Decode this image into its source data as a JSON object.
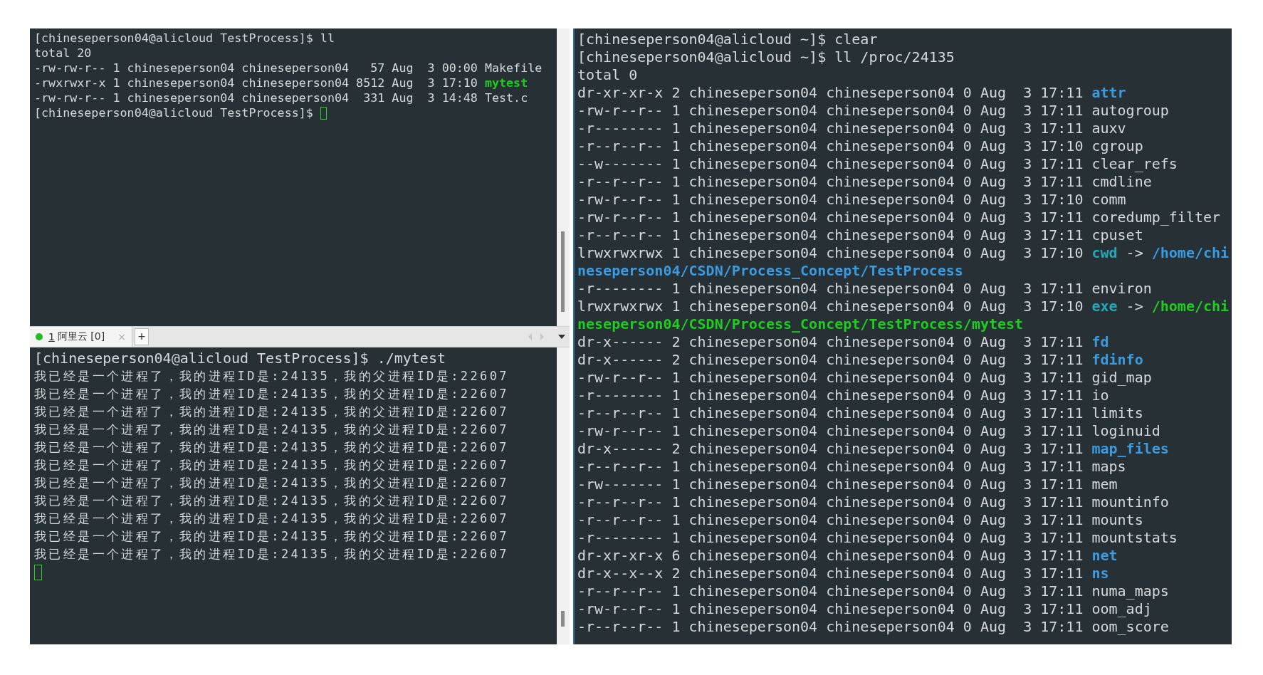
{
  "top_left_terminal": {
    "lines": [
      {
        "kind": "text",
        "text": "[chineseperson04@alicloud TestProcess]$ ll"
      },
      {
        "kind": "text",
        "text": "total 20"
      },
      {
        "kind": "listing",
        "details": "-rw-rw-r-- 1 chineseperson04 chineseperson04   57 Aug  3 00:00",
        "name": {
          "text": "Makefile",
          "kind": "file"
        }
      },
      {
        "kind": "listing",
        "details": "-rwxrwxr-x 1 chineseperson04 chineseperson04 8512 Aug  3 17:10",
        "name": {
          "text": "mytest",
          "kind": "exec"
        }
      },
      {
        "kind": "listing",
        "details": "-rw-rw-r-- 1 chineseperson04 chineseperson04  331 Aug  3 14:48",
        "name": {
          "text": "Test.c",
          "kind": "file"
        }
      },
      {
        "kind": "text",
        "text": "[chineseperson04@alicloud TestProcess]$",
        "cursor": true
      }
    ]
  },
  "tab_bar": {
    "tabs": [
      {
        "number": "1",
        "label": "阿里云 [0]",
        "color": "#22bb22",
        "close": "×",
        "selected": true
      }
    ],
    "add": "+"
  },
  "bottom_left_terminal": {
    "lines": [
      {
        "kind": "text",
        "text": "[chineseperson04@alicloud TestProcess]$ ./mytest"
      },
      {
        "kind": "output",
        "text": "我已经是一个进程了，我的进程ID是:24135，我的父进程ID是:22607"
      },
      {
        "kind": "output",
        "text": "我已经是一个进程了，我的进程ID是:24135，我的父进程ID是:22607"
      },
      {
        "kind": "output",
        "text": "我已经是一个进程了，我的进程ID是:24135，我的父进程ID是:22607"
      },
      {
        "kind": "output",
        "text": "我已经是一个进程了，我的进程ID是:24135，我的父进程ID是:22607"
      },
      {
        "kind": "output",
        "text": "我已经是一个进程了，我的进程ID是:24135，我的父进程ID是:22607"
      },
      {
        "kind": "output",
        "text": "我已经是一个进程了，我的进程ID是:24135，我的父进程ID是:22607"
      },
      {
        "kind": "output",
        "text": "我已经是一个进程了，我的进程ID是:24135，我的父进程ID是:22607"
      },
      {
        "kind": "output",
        "text": "我已经是一个进程了，我的进程ID是:24135，我的父进程ID是:22607"
      },
      {
        "kind": "output",
        "text": "我已经是一个进程了，我的进程ID是:24135，我的父进程ID是:22607"
      },
      {
        "kind": "output",
        "text": "我已经是一个进程了，我的进程ID是:24135，我的父进程ID是:22607"
      },
      {
        "kind": "output",
        "text": "我已经是一个进程了，我的进程ID是:24135，我的父进程ID是:22607"
      },
      {
        "kind": "empty",
        "cursor": true
      }
    ]
  },
  "right_terminal": {
    "lines": [
      {
        "kind": "text",
        "text": "[chineseperson04@alicloud ~]$ clear"
      },
      {
        "kind": "text",
        "text": "[chineseperson04@alicloud ~]$ ll /proc/24135"
      },
      {
        "kind": "text",
        "text": "total 0"
      },
      {
        "kind": "listing",
        "details": "dr-xr-xr-x 2 chineseperson04 chineseperson04 0 Aug  3 17:11",
        "name": {
          "text": "attr",
          "kind": "dir"
        }
      },
      {
        "kind": "listing",
        "details": "-rw-r--r-- 1 chineseperson04 chineseperson04 0 Aug  3 17:11",
        "name": {
          "text": "autogroup",
          "kind": "file"
        }
      },
      {
        "kind": "listing",
        "details": "-r-------- 1 chineseperson04 chineseperson04 0 Aug  3 17:11",
        "name": {
          "text": "auxv",
          "kind": "file"
        }
      },
      {
        "kind": "listing",
        "details": "-r--r--r-- 1 chineseperson04 chineseperson04 0 Aug  3 17:10",
        "name": {
          "text": "cgroup",
          "kind": "file"
        }
      },
      {
        "kind": "listing",
        "details": "--w------- 1 chineseperson04 chineseperson04 0 Aug  3 17:11",
        "name": {
          "text": "clear_refs",
          "kind": "file"
        }
      },
      {
        "kind": "listing",
        "details": "-r--r--r-- 1 chineseperson04 chineseperson04 0 Aug  3 17:11",
        "name": {
          "text": "cmdline",
          "kind": "file"
        }
      },
      {
        "kind": "listing",
        "details": "-rw-r--r-- 1 chineseperson04 chineseperson04 0 Aug  3 17:10",
        "name": {
          "text": "comm",
          "kind": "file"
        }
      },
      {
        "kind": "listing",
        "details": "-rw-r--r-- 1 chineseperson04 chineseperson04 0 Aug  3 17:11",
        "name": {
          "text": "coredump_filter",
          "kind": "file"
        }
      },
      {
        "kind": "listing",
        "details": "-r--r--r-- 1 chineseperson04 chineseperson04 0 Aug  3 17:11",
        "name": {
          "text": "cpuset",
          "kind": "file"
        }
      },
      {
        "kind": "listing",
        "details": "lrwxrwxrwx 1 chineseperson04 chineseperson04 0 Aug  3 17:10",
        "name": {
          "text": "cwd",
          "kind": "link"
        },
        "arrow": "->",
        "target": {
          "text": "/home/chi",
          "continued": "neseperson04/CSDN/Process_Concept/TestProcess",
          "kind": "dir"
        }
      },
      {
        "kind": "listing",
        "details": "-r-------- 1 chineseperson04 chineseperson04 0 Aug  3 17:11",
        "name": {
          "text": "environ",
          "kind": "file"
        }
      },
      {
        "kind": "listing",
        "details": "lrwxrwxrwx 1 chineseperson04 chineseperson04 0 Aug  3 17:10",
        "name": {
          "text": "exe",
          "kind": "link"
        },
        "arrow": "->",
        "target": {
          "text": "/home/chi",
          "continued": "neseperson04/CSDN/Process_Concept/TestProcess/mytest",
          "kind": "exec"
        }
      },
      {
        "kind": "listing",
        "details": "dr-x------ 2 chineseperson04 chineseperson04 0 Aug  3 17:11",
        "name": {
          "text": "fd",
          "kind": "dir"
        }
      },
      {
        "kind": "listing",
        "details": "dr-x------ 2 chineseperson04 chineseperson04 0 Aug  3 17:11",
        "name": {
          "text": "fdinfo",
          "kind": "dir"
        }
      },
      {
        "kind": "listing",
        "details": "-rw-r--r-- 1 chineseperson04 chineseperson04 0 Aug  3 17:11",
        "name": {
          "text": "gid_map",
          "kind": "file"
        }
      },
      {
        "kind": "listing",
        "details": "-r-------- 1 chineseperson04 chineseperson04 0 Aug  3 17:11",
        "name": {
          "text": "io",
          "kind": "file"
        }
      },
      {
        "kind": "listing",
        "details": "-r--r--r-- 1 chineseperson04 chineseperson04 0 Aug  3 17:11",
        "name": {
          "text": "limits",
          "kind": "file"
        }
      },
      {
        "kind": "listing",
        "details": "-rw-r--r-- 1 chineseperson04 chineseperson04 0 Aug  3 17:11",
        "name": {
          "text": "loginuid",
          "kind": "file"
        }
      },
      {
        "kind": "listing",
        "details": "dr-x------ 2 chineseperson04 chineseperson04 0 Aug  3 17:11",
        "name": {
          "text": "map_files",
          "kind": "dir"
        }
      },
      {
        "kind": "listing",
        "details": "-r--r--r-- 1 chineseperson04 chineseperson04 0 Aug  3 17:11",
        "name": {
          "text": "maps",
          "kind": "file"
        }
      },
      {
        "kind": "listing",
        "details": "-rw------- 1 chineseperson04 chineseperson04 0 Aug  3 17:11",
        "name": {
          "text": "mem",
          "kind": "file"
        }
      },
      {
        "kind": "listing",
        "details": "-r--r--r-- 1 chineseperson04 chineseperson04 0 Aug  3 17:11",
        "name": {
          "text": "mountinfo",
          "kind": "file"
        }
      },
      {
        "kind": "listing",
        "details": "-r--r--r-- 1 chineseperson04 chineseperson04 0 Aug  3 17:11",
        "name": {
          "text": "mounts",
          "kind": "file"
        }
      },
      {
        "kind": "listing",
        "details": "-r-------- 1 chineseperson04 chineseperson04 0 Aug  3 17:11",
        "name": {
          "text": "mountstats",
          "kind": "file"
        }
      },
      {
        "kind": "listing",
        "details": "dr-xr-xr-x 6 chineseperson04 chineseperson04 0 Aug  3 17:11",
        "name": {
          "text": "net",
          "kind": "dir"
        }
      },
      {
        "kind": "listing",
        "details": "dr-x--x--x 2 chineseperson04 chineseperson04 0 Aug  3 17:11",
        "name": {
          "text": "ns",
          "kind": "dir"
        }
      },
      {
        "kind": "listing",
        "details": "-r--r--r-- 1 chineseperson04 chineseperson04 0 Aug  3 17:11",
        "name": {
          "text": "numa_maps",
          "kind": "file"
        }
      },
      {
        "kind": "listing",
        "details": "-rw-r--r-- 1 chineseperson04 chineseperson04 0 Aug  3 17:11",
        "name": {
          "text": "oom_adj",
          "kind": "file"
        }
      },
      {
        "kind": "listing",
        "details": "-r--r--r-- 1 chineseperson04 chineseperson04 0 Aug  3 17:11",
        "name": {
          "text": "oom_score",
          "kind": "file"
        }
      }
    ]
  }
}
